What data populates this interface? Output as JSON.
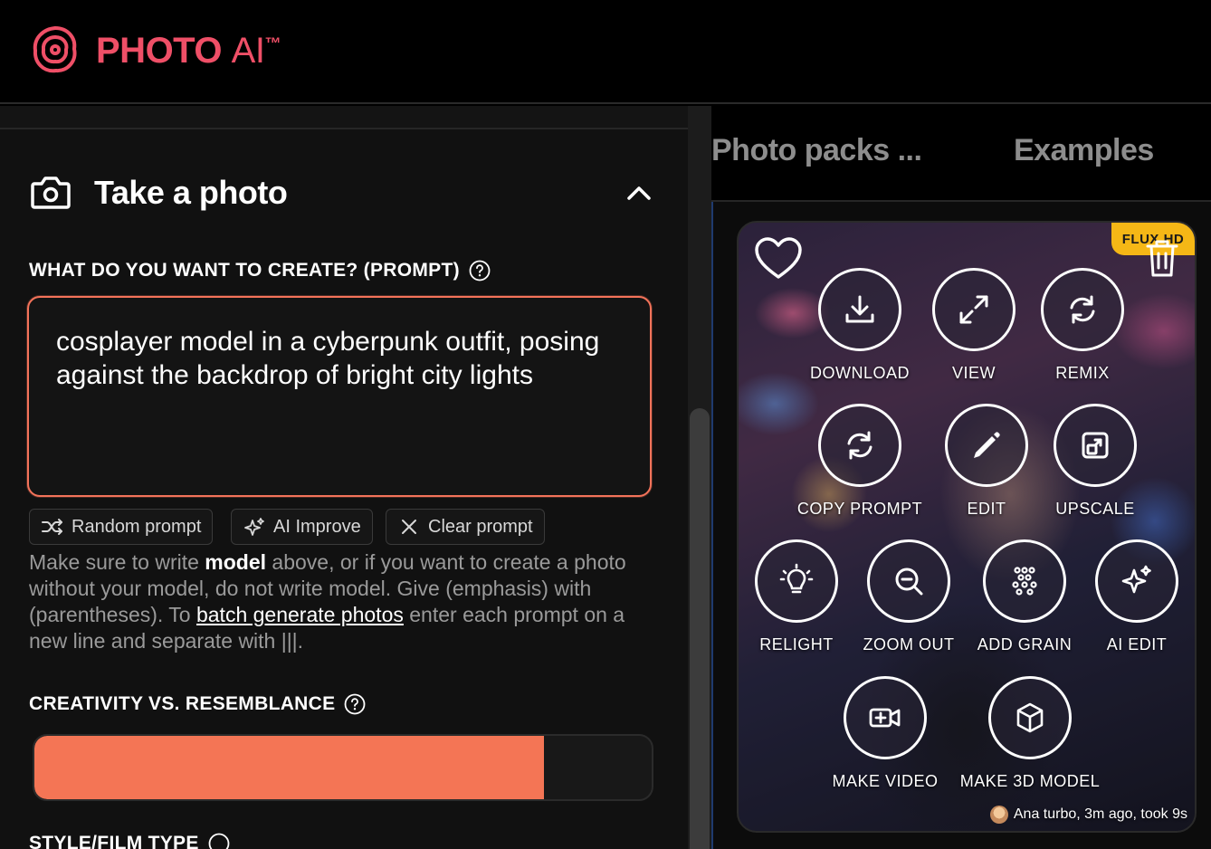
{
  "header": {
    "brand_main": "PHOTO",
    "brand_ai": "AI",
    "brand_tm": "™",
    "brand_color": "#ef4f67"
  },
  "left": {
    "section_title": "Take a photo",
    "prompt_label": "WHAT DO YOU WANT TO CREATE? (PROMPT)",
    "prompt_value": "cosplayer model in a cyberpunk outfit, posing against the backdrop of bright city lights",
    "chips": [
      {
        "label": "Random prompt",
        "icon": "shuffle-icon"
      },
      {
        "label": "AI Improve",
        "icon": "sparkle-icon"
      },
      {
        "label": "Clear prompt",
        "icon": "x-icon"
      }
    ],
    "help": {
      "t1": "Make sure to write ",
      "b1": "model",
      "t2": " above, or if you want to create a photo without your model, do not write model. Give (emphasis) with (parentheses). To ",
      "link": "batch generate photos",
      "t3": " enter each prompt on a new line and separate with |||."
    },
    "creativity_label": "CREATIVITY VS. RESEMBLANCE",
    "creativity_value": 0.825,
    "style_label": "STYLE/FILM TYPE",
    "accent_color": "#f47555"
  },
  "right": {
    "tabs": [
      "Photo packs ...",
      "Examples"
    ],
    "badge": "FLUX HD",
    "actions": [
      {
        "label": "DOWNLOAD",
        "icon": "download-icon"
      },
      {
        "label": "VIEW",
        "icon": "expand-icon"
      },
      {
        "label": "REMIX",
        "icon": "refresh-icon"
      },
      {
        "label": "COPY PROMPT",
        "icon": "sync-icon"
      },
      {
        "label": "EDIT",
        "icon": "pencil-icon"
      },
      {
        "label": "UPSCALE",
        "icon": "upscale-icon"
      },
      {
        "label": "RELIGHT",
        "icon": "bulb-icon"
      },
      {
        "label": "ZOOM OUT",
        "icon": "zoom-out-icon"
      },
      {
        "label": "ADD GRAIN",
        "icon": "grain-icon"
      },
      {
        "label": "AI EDIT",
        "icon": "sparkle-icon"
      },
      {
        "label": "MAKE VIDEO",
        "icon": "video-plus-icon"
      },
      {
        "label": "MAKE 3D MODEL",
        "icon": "cube-icon"
      }
    ],
    "caption": "Ana turbo, 3m ago, took 9s"
  }
}
